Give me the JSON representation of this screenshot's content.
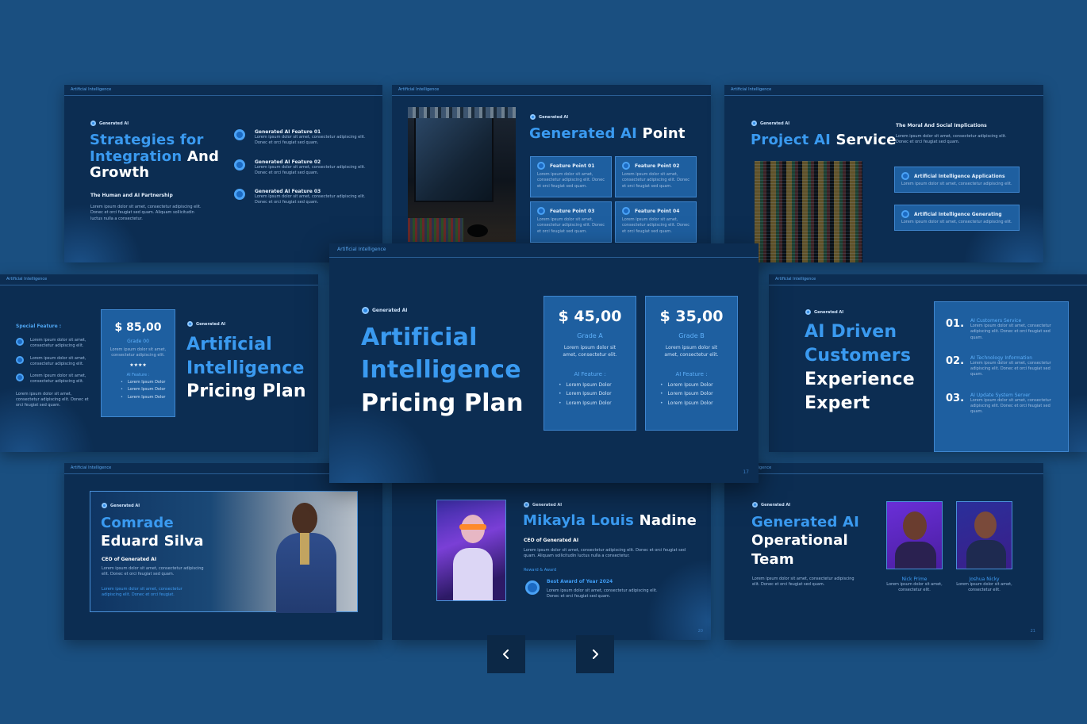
{
  "common": {
    "tag": "Artificial Intelligence",
    "kicker": "Generated AI",
    "lorem_short": "Lorem ipsum dolor sit amet, consectetur adipiscing elit.",
    "lorem_mid": "Lorem ipsum dolor sit amet, consectetur adipiscing elit. Donec et orci feugiat sed quam.",
    "lorem_long": "Lorem ipsum dolor sit amet, consectetur adipiscing elit. Donec et orci feugiat sed quam. Aliquam sollicitudin luctus nulla a consectetur."
  },
  "slide_strategies": {
    "title_blue": "Strategies for Integration",
    "title_white": "And Growth",
    "subtitle": "The Human and AI Partnership",
    "features": [
      "Generated AI Feature 01",
      "Generated AI Feature 02",
      "Generated AI Feature 03"
    ]
  },
  "slide_point": {
    "title_blue": "Generated AI",
    "title_white": "Point",
    "points": [
      "Feature Point 01",
      "Feature Point 02",
      "Feature Point 03",
      "Feature Point 04"
    ]
  },
  "slide_project": {
    "title_blue": "Project AI",
    "title_white": "Service",
    "heading": "The Moral And Social Implications",
    "items": [
      "Artificial Intelligence Applications",
      "Artificial Intelligence Generating"
    ]
  },
  "slide_pricing_left": {
    "special_label": "Special Feature :",
    "price": "$ 85,00",
    "grade": "Grade 00",
    "stars": "★★★★",
    "feature_label": "AI Feature :",
    "bullets": [
      "Lorem Ipsum Dolor",
      "Lorem Ipsum Dolor",
      "Lorem Ipsum Dolor"
    ],
    "title_blue": "Artificial Intelligence",
    "title_white": "Pricing Plan"
  },
  "slide_pricing_main": {
    "title_blue": "Artificial Intelligence",
    "title_white": "Pricing Plan",
    "page": "17",
    "plans": [
      {
        "price": "$ 45,00",
        "grade": "Grade A",
        "desc": "Lorem ipsum dolor sit amet, consectetur elit.",
        "feature_label": "AI Feature :",
        "bullets": [
          "Lorem Ipsum Dolor",
          "Lorem Ipsum Dolor",
          "Lorem Ipsum Dolor"
        ]
      },
      {
        "price": "$ 35,00",
        "grade": "Grade B",
        "desc": "Lorem ipsum dolor sit amet, consectetur elit.",
        "feature_label": "AI Feature :",
        "bullets": [
          "Lorem Ipsum Dolor",
          "Lorem Ipsum Dolor",
          "Lorem Ipsum Dolor"
        ]
      }
    ]
  },
  "slide_driven": {
    "title_blue": "AI Driven Customers",
    "title_white": "Experience Expert",
    "items": [
      {
        "num": "01.",
        "label": "AI Customers Service"
      },
      {
        "num": "02.",
        "label": "AI Technology Information"
      },
      {
        "num": "03.",
        "label": "AI Update System Server"
      }
    ]
  },
  "slide_comrade": {
    "title_blue": "Comrade",
    "title_white": "Eduard Silva",
    "role": "CEO of Generated AI",
    "link_text": "Lorem ipsum dolor sit amet, consectetur adipiscing elit. Donec et orci feugiat."
  },
  "slide_mikayla": {
    "title_blue": "Mikayla Louis",
    "title_white": "Nadine",
    "role": "CEO of Generated AI",
    "reward_label": "Reward & Award",
    "award_title": "Best Award of Year 2024",
    "page": "20"
  },
  "slide_team": {
    "title_blue": "Generated AI",
    "title_white": "Operational Team",
    "members": [
      {
        "name": "Nick Prime",
        "desc": "Lorem ipsum dolor sit amet, consectetur elit."
      },
      {
        "name": "Joshua Nicky",
        "desc": "Lorem ipsum dolor sit amet, consectetur elit."
      }
    ],
    "page": "21"
  },
  "nav": {
    "prev": "previous",
    "next": "next"
  }
}
